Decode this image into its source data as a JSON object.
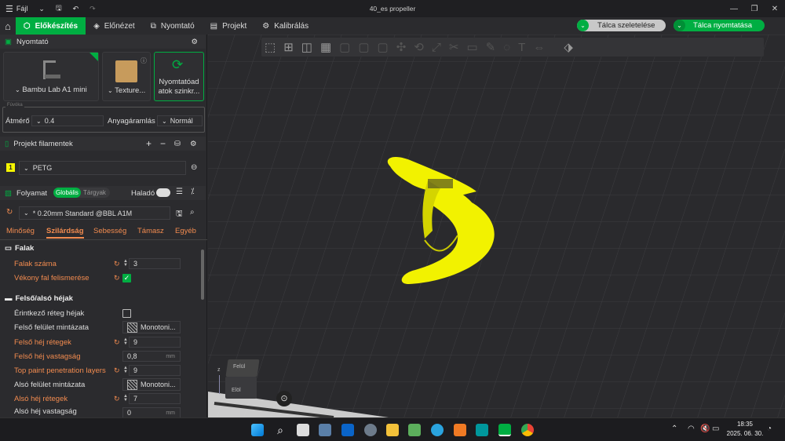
{
  "titlebar": {
    "menu_label": "Fájl",
    "title": "40_es propeller"
  },
  "tabs": [
    {
      "label": "Előkészítés"
    },
    {
      "label": "Előnézet"
    },
    {
      "label": "Nyomtató"
    },
    {
      "label": "Projekt"
    },
    {
      "label": "Kalibrálás"
    }
  ],
  "actions": {
    "slice_label": "Tálca szeletelése",
    "print_label": "Tálca nyomtatása"
  },
  "printer": {
    "section_title": "Nyomtató",
    "printer_name": "Bambu Lab A1 mini",
    "plate_name": "Texture...",
    "sync_label_1": "Nyomtatóad",
    "sync_label_2": "atok szinkr...",
    "nozzle_label": "Fúvóka",
    "diameter_label": "Átmérő",
    "diameter_value": "0.4",
    "flow_label": "Anyagáramlás",
    "flow_value": "Normál"
  },
  "filaments": {
    "section_title": "Projekt filamentek",
    "slot": "1",
    "name": "PETG"
  },
  "process": {
    "section_title": "Folyamat",
    "global_label": "Globális",
    "objects_label": "Tárgyak",
    "advanced_label": "Haladó",
    "preset": "* 0.20mm Standard @BBL A1M"
  },
  "setting_tabs": [
    "Minőség",
    "Szilárdság",
    "Sebesség",
    "Támasz",
    "Egyéb"
  ],
  "groups": {
    "walls": "Falak",
    "shells": "Felső/alsó héjak"
  },
  "settings": {
    "wall_loops": {
      "label": "Falak száma",
      "value": "3"
    },
    "thin_wall": {
      "label": "Vékony fal felismerése"
    },
    "interface_shells": {
      "label": "Érintkező réteg héjak"
    },
    "top_pattern": {
      "label": "Felső felület mintázata",
      "value": "Monotoni..."
    },
    "top_layers": {
      "label": "Felső héj rétegek",
      "value": "9"
    },
    "top_thickness": {
      "label": "Felső héj vastagság",
      "value": "0,8",
      "unit": "mm"
    },
    "top_paint": {
      "label": "Top paint penetration layers",
      "value": "9"
    },
    "bottom_pattern": {
      "label": "Alsó felület mintázata",
      "value": "Monotoni..."
    },
    "bottom_layers": {
      "label": "Alsó héj rétegek",
      "value": "7"
    },
    "bottom_thickness": {
      "label": "Alsó héj vastagság",
      "value": "0",
      "unit": "mm"
    }
  },
  "viewcube": {
    "top": "Felül",
    "front": "Elöl"
  },
  "axes": {
    "z": "z"
  },
  "clock": {
    "time": "18:35",
    "date": "2025. 06. 30."
  },
  "colors": {
    "accent": "#00ae42",
    "changed": "#f28b4f",
    "model": "#f5f500"
  }
}
